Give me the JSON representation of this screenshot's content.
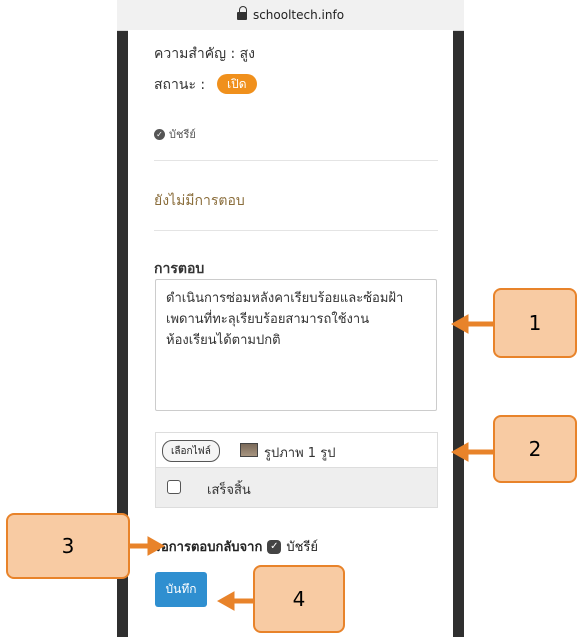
{
  "browser": {
    "url": "schooltech.info"
  },
  "ticket": {
    "priority": "ความสำคัญ : สูง",
    "status_label": "สถานะ :",
    "status_badge": "เปิด",
    "verified_by": "บัชรีย์",
    "no_reply": "ยังไม่มีการตอบ"
  },
  "reply_form": {
    "heading": "การตอบ",
    "reply_text": "ดำเนินการซ่อมหลังคาเรียบร้อยและซ้อมฝ้า\nเพดานที่ทะลุเรียบร้อยสามารถใช้งาน\nห้องเรียนได้ตามปกติ",
    "choose_file_label": "เลือกไฟล์",
    "file_count": "รูปภาพ 1 รูป",
    "done_label": "เสร็จสิ้น",
    "done_checked": false,
    "await_label": "รอการตอบกลับจาก",
    "await_user": "บัชรีย์",
    "save_label": "บันทึก"
  },
  "callouts": [
    "1",
    "2",
    "3",
    "4"
  ],
  "colors": {
    "accent": "#f0901c",
    "save": "#2f8fd0",
    "callout_fill": "#f8cba3",
    "callout_border": "#e8832a"
  }
}
